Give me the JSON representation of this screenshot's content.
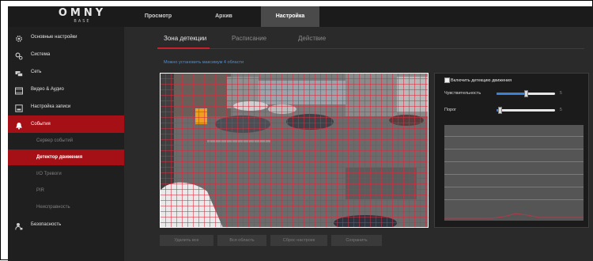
{
  "app": {
    "logo_main": "OMNY",
    "logo_sub": "BASE"
  },
  "topnav": {
    "items": [
      {
        "label": "Просмотр"
      },
      {
        "label": "Архив"
      },
      {
        "label": "Настройка",
        "active": true
      }
    ]
  },
  "sidebar": {
    "items": [
      {
        "label": "Основные настройки",
        "icon": "gear-icon"
      },
      {
        "label": "Система",
        "icon": "gears-icon"
      },
      {
        "label": "Сеть",
        "icon": "network-icon"
      },
      {
        "label": "Видео & Аудио",
        "icon": "film-icon"
      },
      {
        "label": "Настройка записи",
        "icon": "storage-icon"
      },
      {
        "label": "События",
        "icon": "bell-icon",
        "active": true
      }
    ],
    "subitems": [
      {
        "label": "Сервер событий"
      },
      {
        "label": "Детектор движения",
        "active": true
      },
      {
        "label": "I/O Тревоги"
      },
      {
        "label": "PIR"
      },
      {
        "label": "Неисправность"
      }
    ],
    "security": {
      "label": "Безопасность",
      "icon": "user-lock-icon"
    }
  },
  "tabs": [
    {
      "label": "Зона детекции",
      "active": true
    },
    {
      "label": "Расписание"
    },
    {
      "label": "Действие"
    }
  ],
  "note": "Можно установить максимум 4 области",
  "settings": {
    "enable_label": "Включить детекцию движения",
    "enabled": true,
    "sensitivity": {
      "label": "Чувствительность",
      "value": "5",
      "fraction": 0.5
    },
    "threshold": {
      "label": "Порог",
      "value": "5",
      "fraction": 0.05
    }
  },
  "buttons": {
    "delete_all": "Удалить все",
    "all_area": "Вся область",
    "reset": "Сброс настроек",
    "save": "Сохранить"
  },
  "colors": {
    "accent_red": "#a50f16",
    "link_blue": "#4d8fd6",
    "slider_blue": "#3b82d6",
    "grid_red": "#dc283c"
  }
}
